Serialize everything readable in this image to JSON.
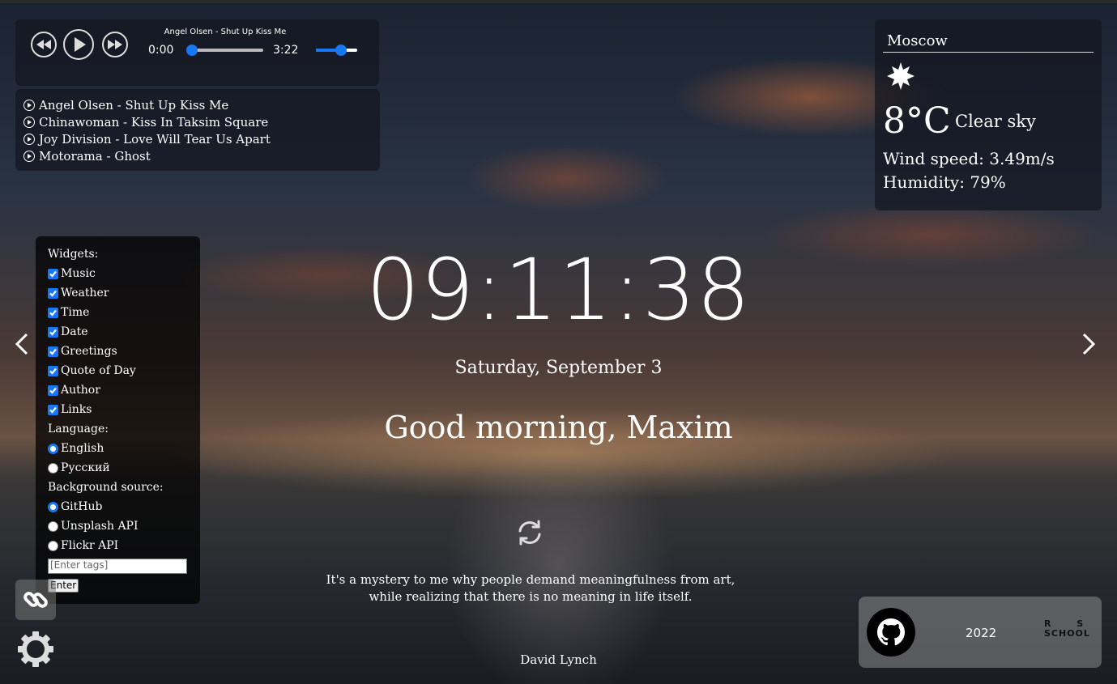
{
  "player": {
    "title": "Angel Olsen - Shut Up Kiss Me",
    "current_time": "0:00",
    "duration": "3:22",
    "progress": 0.0,
    "volume": 0.6,
    "playlist": [
      "Angel Olsen - Shut Up Kiss Me",
      "Chinawoman - Kiss In Taksim Square",
      "Joy Division - Love Will Tear Us Apart",
      "Motorama - Ghost"
    ]
  },
  "weather": {
    "city": "Moscow",
    "icon": "sun-icon",
    "temperature": "8°C",
    "description": "Clear sky",
    "wind": "Wind speed: 3.49m/s",
    "humidity": "Humidity: 79%"
  },
  "settings": {
    "widgets_label": "Widgets:",
    "widgets": [
      {
        "label": "Music",
        "checked": true
      },
      {
        "label": "Weather",
        "checked": true
      },
      {
        "label": "Time",
        "checked": true
      },
      {
        "label": "Date",
        "checked": true
      },
      {
        "label": "Greetings",
        "checked": true
      },
      {
        "label": "Quote of Day",
        "checked": true
      },
      {
        "label": "Author",
        "checked": true
      },
      {
        "label": "Links",
        "checked": true
      }
    ],
    "language_label": "Language:",
    "languages": [
      {
        "label": "English",
        "selected": true
      },
      {
        "label": "Русский",
        "selected": false
      }
    ],
    "source_label": "Background source:",
    "sources": [
      {
        "label": "GitHub",
        "selected": true
      },
      {
        "label": "Unsplash API",
        "selected": false
      },
      {
        "label": "Flickr API",
        "selected": false
      }
    ],
    "tags_placeholder": "[Enter tags]",
    "enter_label": "Enter"
  },
  "clock": {
    "time": "09:11:38",
    "date": "Saturday, September 3",
    "greeting": "Good morning, ",
    "name": "Maxim"
  },
  "quote": {
    "text": "It's a mystery to me why people demand meaningfulness from art, while realizing that there is no meaning in life itself.",
    "author": "David Lynch"
  },
  "footer": {
    "year": "2022",
    "school_line1": "R S",
    "school_line2": "SCHOOL"
  },
  "colors": {
    "accent": "#1877f2"
  }
}
